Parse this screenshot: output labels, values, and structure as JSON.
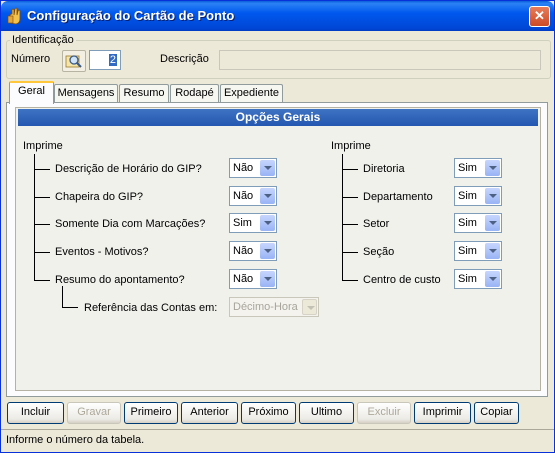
{
  "window": {
    "title": "Configuração do Cartão de Ponto",
    "close_glyph": "✕"
  },
  "identificacao": {
    "legend": "Identificação",
    "numero_label": "Número",
    "numero_value": "2",
    "descricao_label": "Descrição",
    "descricao_value": ""
  },
  "tabs": [
    "Geral",
    "Mensagens",
    "Resumo",
    "Rodapé",
    "Expediente"
  ],
  "panel_title": "Opções Gerais",
  "left": {
    "heading": "Imprime",
    "items": [
      {
        "label": "Descrição de Horário do GIP?",
        "value": "Não"
      },
      {
        "label": "Chapeira do GIP?",
        "value": "Não"
      },
      {
        "label": "Somente Dia com Marcações?",
        "value": "Sim"
      },
      {
        "label": "Eventos - Motivos?",
        "value": "Não"
      },
      {
        "label": "Resumo do apontamento?",
        "value": "Não"
      }
    ],
    "sub_label": "Referência das Contas em:",
    "sub_value": "Décimo-Hora"
  },
  "right": {
    "heading": "Imprime",
    "items": [
      {
        "label": "Diretoria",
        "value": "Sim"
      },
      {
        "label": "Departamento",
        "value": "Sim"
      },
      {
        "label": "Setor",
        "value": "Sim"
      },
      {
        "label": "Seção",
        "value": "Sim"
      },
      {
        "label": "Centro de custo",
        "value": "Sim"
      }
    ]
  },
  "buttons": {
    "incluir": "Incluir",
    "gravar": "Gravar",
    "primeiro": "Primeiro",
    "anterior": "Anterior",
    "proximo": "Próximo",
    "ultimo": "Ultimo",
    "excluir": "Excluir",
    "imprimir": "Imprimir",
    "copiar": "Copiar"
  },
  "status_text": "Informe o número da tabela."
}
